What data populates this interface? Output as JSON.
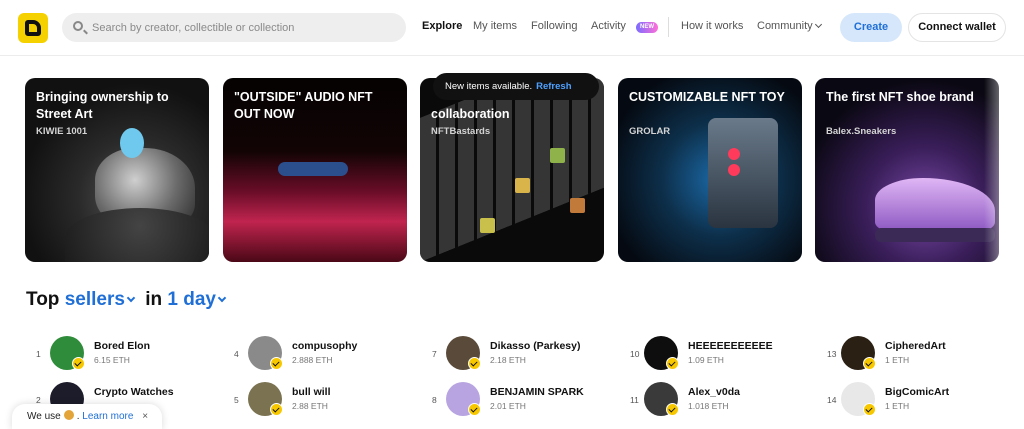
{
  "header": {
    "search_placeholder": "Search by creator, collectible or collection",
    "nav": {
      "explore": "Explore",
      "my_items": "My items",
      "following": "Following",
      "activity": "Activity",
      "activity_badge": "NEW",
      "how_it_works": "How it works",
      "community": "Community"
    },
    "create": "Create",
    "connect_wallet": "Connect wallet"
  },
  "toast": {
    "text": "New items available.",
    "action": "Refresh"
  },
  "featured": [
    {
      "title": "Bringing ownership to Street Art",
      "creator": "KIWIE 1001"
    },
    {
      "title": "\"OUTSIDE\" AUDIO NFT OUT NOW",
      "creator": ""
    },
    {
      "title": "collaboration",
      "creator": "NFTBastards"
    },
    {
      "title": "CUSTOMIZABLE NFT TOY",
      "creator": "GROLAR"
    },
    {
      "title": "The first NFT shoe brand",
      "creator": "Balex.Sneakers"
    }
  ],
  "top_sellers": {
    "title_pre": "Top",
    "title_kind": "sellers",
    "title_mid": "in",
    "title_period": "1 day",
    "sellers": [
      {
        "rank": "1",
        "name": "Bored Elon",
        "eth": "6.15 ETH",
        "avatar_color": "#2f8c3a"
      },
      {
        "rank": "2",
        "name": "Crypto Watches",
        "eth": "",
        "avatar_color": "#1c1c2a"
      },
      {
        "rank": "4",
        "name": "compusophy",
        "eth": "2.888 ETH",
        "avatar_color": "#8a8a8a"
      },
      {
        "rank": "5",
        "name": "bull will",
        "eth": "2.88 ETH",
        "avatar_color": "#7a7250"
      },
      {
        "rank": "7",
        "name": "Dikasso (Parkesy)",
        "eth": "2.18 ETH",
        "avatar_color": "#5a4a3a"
      },
      {
        "rank": "8",
        "name": "BENJAMIN SPARK",
        "eth": "2.01 ETH",
        "avatar_color": "#b7a4e0"
      },
      {
        "rank": "10",
        "name": "HEEEEEEEEEEE",
        "eth": "1.09 ETH",
        "avatar_color": "#0e0e0e"
      },
      {
        "rank": "11",
        "name": "Alex_v0da",
        "eth": "1.018 ETH",
        "avatar_color": "#3a3a3a"
      },
      {
        "rank": "13",
        "name": "CipheredArt",
        "eth": "1 ETH",
        "avatar_color": "#2a2014"
      },
      {
        "rank": "14",
        "name": "BigComicArt",
        "eth": "1 ETH",
        "avatar_color": "#e8e8e8"
      }
    ]
  },
  "cookie": {
    "text": "We use",
    "learn_more": "Learn more",
    "close": "×"
  }
}
